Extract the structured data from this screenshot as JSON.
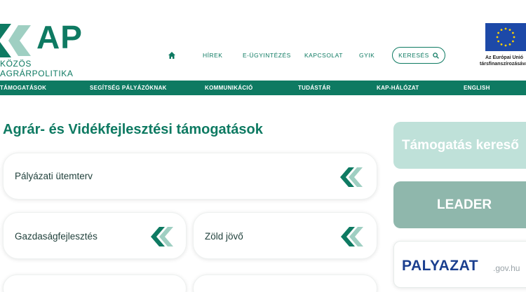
{
  "header": {
    "logo_letters": "AP",
    "logo_subtitle": "KÖZÖS AGRÁRPOLITIKA",
    "nav": [
      "HÍREK",
      "E-ÜGYINTÉZÉS",
      "KAPCSOLAT",
      "GYIK"
    ],
    "search_label": "KERESÉS",
    "eu_text_line1": "Az Európai Unió",
    "eu_text_line2": "társfinanszírozásával"
  },
  "menu": [
    "TÁMOGATÁSOK",
    "SEGÍTSÉG PÁLYÁZÓKNAK",
    "KOMMUNIKÁCIÓ",
    "TUDÁSTÁR",
    "KAP-HÁLÓZAT",
    "ENGLISH"
  ],
  "main": {
    "title": "Agrár- és Vidékfejlesztési támogatások",
    "cards": [
      "Pályázati ütemterv",
      "Gazdaságfejlesztés",
      "Zöld jövő"
    ]
  },
  "sidebar": {
    "support_search": "Támogatás kereső",
    "leader": "LEADER",
    "palyazat_main": "PALYAZAT",
    "palyazat_domain": ".gov.hu"
  },
  "colors": {
    "brand_green": "#0e7a62",
    "light_teal": "#bfe1d9",
    "muted_teal": "#8fb7ac",
    "palyazat_blue": "#1b3f8f"
  },
  "icons": [
    "home-icon",
    "search-icon",
    "chevron-logo-icon",
    "eu-flag-icon"
  ]
}
